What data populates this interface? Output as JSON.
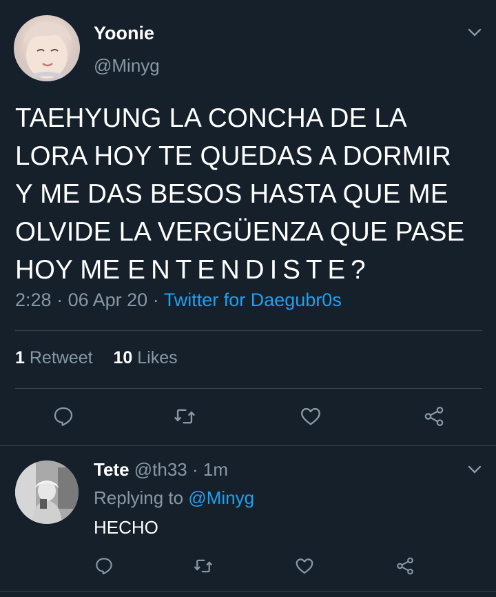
{
  "tweet": {
    "display_name": "Yoonie",
    "handle": "@Minyg",
    "text_lines": [
      "TAEHYUNG LA CONCHA DE LA",
      "LORA HOY TE QUEDAS A DORMIR",
      "Y ME DAS BESOS HASTA QUE ME",
      "OLVIDE LA VERGÜENZA QUE PASE"
    ],
    "text_last_prefix": "HOY ME ",
    "text_last_spaced": "ENTENDISTE?",
    "time": "2:28",
    "date": "06 Apr 20",
    "separator": "·",
    "source": "Twitter for Daegubr0s",
    "retweets_count": "1",
    "retweets_label": "Retweet",
    "likes_count": "10",
    "likes_label": "Likes"
  },
  "reply": {
    "display_name": "Tete",
    "handle": "@th33",
    "separator": "·",
    "age": "1m",
    "replying_prefix": "Replying to",
    "replying_to": "@Minyg",
    "text": "HECHO"
  },
  "icons": {
    "chevron": "chevron-down-icon",
    "reply": "reply-icon",
    "retweet": "retweet-icon",
    "like": "heart-icon",
    "share": "share-icon"
  },
  "colors": {
    "background": "#15202b",
    "muted": "#8899a6",
    "link": "#1da1f2",
    "divider": "#38444d"
  }
}
